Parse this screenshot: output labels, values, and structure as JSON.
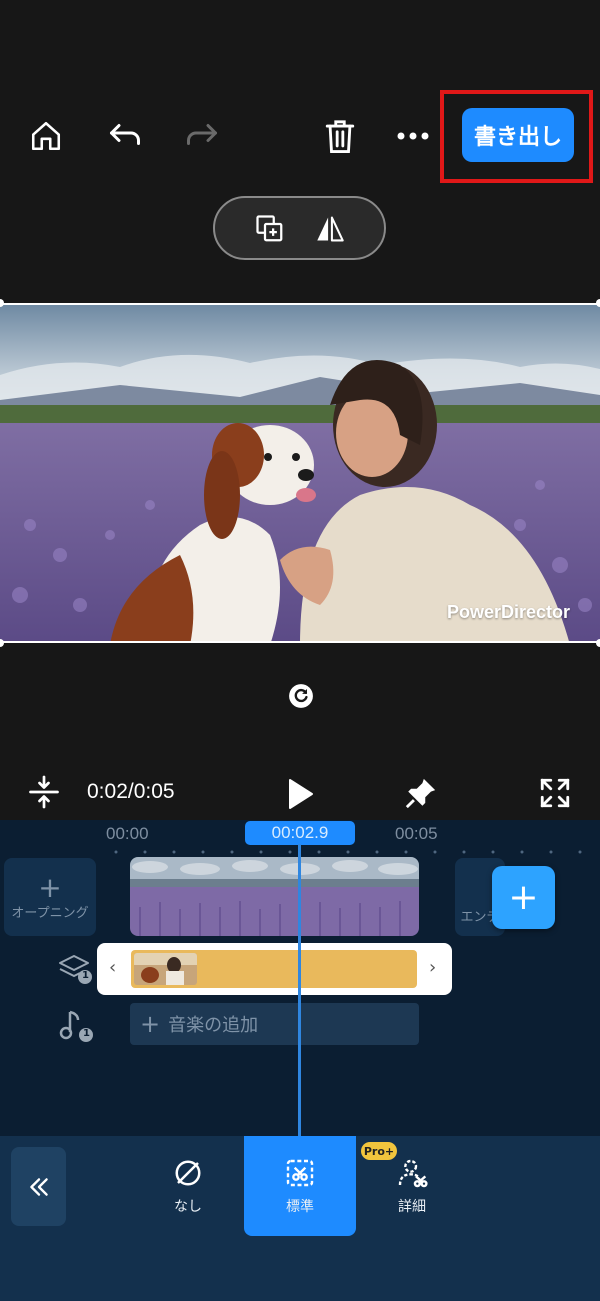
{
  "toolbar": {
    "home_icon": "home-icon",
    "undo_icon": "undo-icon",
    "redo_icon": "redo-icon",
    "delete_icon": "trash-icon",
    "more_icon": "more-dots-icon",
    "export_label": "書き出し",
    "accent_color": "#1e8bff",
    "highlight_color": "#e01818"
  },
  "pill": {
    "duplicate_icon": "duplicate-icon",
    "flip_icon": "flip-icon"
  },
  "preview": {
    "watermark": "PowerDirector",
    "reset_icon": "reset-icon"
  },
  "playback": {
    "time": "0:02/0:05",
    "play_icon": "play-icon",
    "pin_icon": "pin-icon",
    "fullscreen_icon": "fullscreen-icon",
    "split_height_icon": "expand-vertical-icon"
  },
  "timeline": {
    "tick_start": "00:00",
    "tick_end": "00:05",
    "current_marker": "00:02.9",
    "opening_label": "オープニング",
    "ending_label": "エンデ",
    "add_button": "+",
    "layer_count": "1",
    "music_count": "1",
    "music_add_label": "音楽の追加"
  },
  "bottom_panel": {
    "collapse_icon": "double-chevron-left-icon",
    "options": [
      {
        "label": "なし",
        "icon": "none-icon"
      },
      {
        "label": "標準",
        "icon": "cutout-standard-icon"
      },
      {
        "label": "詳細",
        "icon": "cutout-detail-icon"
      }
    ],
    "pro_badge": "Pro+",
    "selected_index": 1
  }
}
